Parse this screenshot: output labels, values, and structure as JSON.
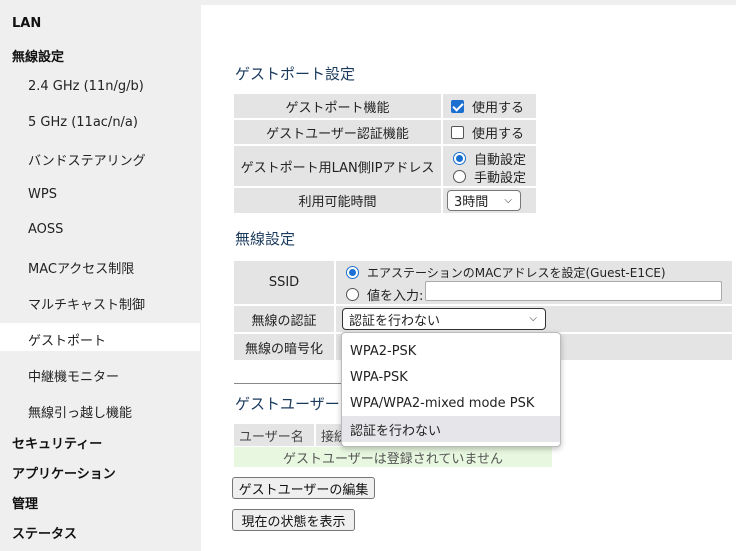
{
  "sidebar": {
    "lan": "LAN",
    "wireless": "無線設定",
    "sub_items": [
      "2.4 GHz (11n/g/b)",
      "5 GHz (11ac/n/a)",
      "バンドステアリング",
      "WPS",
      "AOSS",
      "MACアクセス制限",
      "マルチキャスト制御",
      "ゲストポート",
      "中継機モニター",
      "無線引っ越し機能"
    ],
    "security": "セキュリティー",
    "application": "アプリケーション",
    "management": "管理",
    "status": "ステータス"
  },
  "guest_port": {
    "title": "ゲストポート設定",
    "rows": {
      "function_label": "ゲストポート機能",
      "function_value": "使用する",
      "auth_label": "ゲストユーザー認証機能",
      "auth_value": "使用する",
      "ip_label": "ゲストポート用LAN側IPアドレス",
      "ip_auto": "自動設定",
      "ip_manual": "手動設定",
      "time_label": "利用可能時間",
      "time_value": "3時間"
    }
  },
  "wireless": {
    "title": "無線設定",
    "ssid_label": "SSID",
    "ssid_opt1": "エアステーションのMACアドレスを設定(Guest-E1CE)",
    "ssid_opt2": "値を入力:",
    "auth_label": "無線の認証",
    "auth_value": "認証を行わない",
    "enc_label": "無線の暗号化",
    "auth_options": [
      "WPA2-PSK",
      "WPA-PSK",
      "WPA/WPA2-mixed mode PSK",
      "認証を行わない"
    ]
  },
  "guest_users": {
    "title_visible": "ゲストユーザー",
    "col_user": "ユーザー名",
    "col_conn": "接続",
    "empty_msg": "ゲストユーザーは登録されていません",
    "edit_button": "ゲストユーザーの編集",
    "status_button": "現在の状態を表示"
  },
  "colors": {
    "accent": "#1a6fd1",
    "title": "#1a3a5c",
    "cell_bg": "#e4e4e4",
    "empty_row_bg": "#e8f8e0"
  }
}
